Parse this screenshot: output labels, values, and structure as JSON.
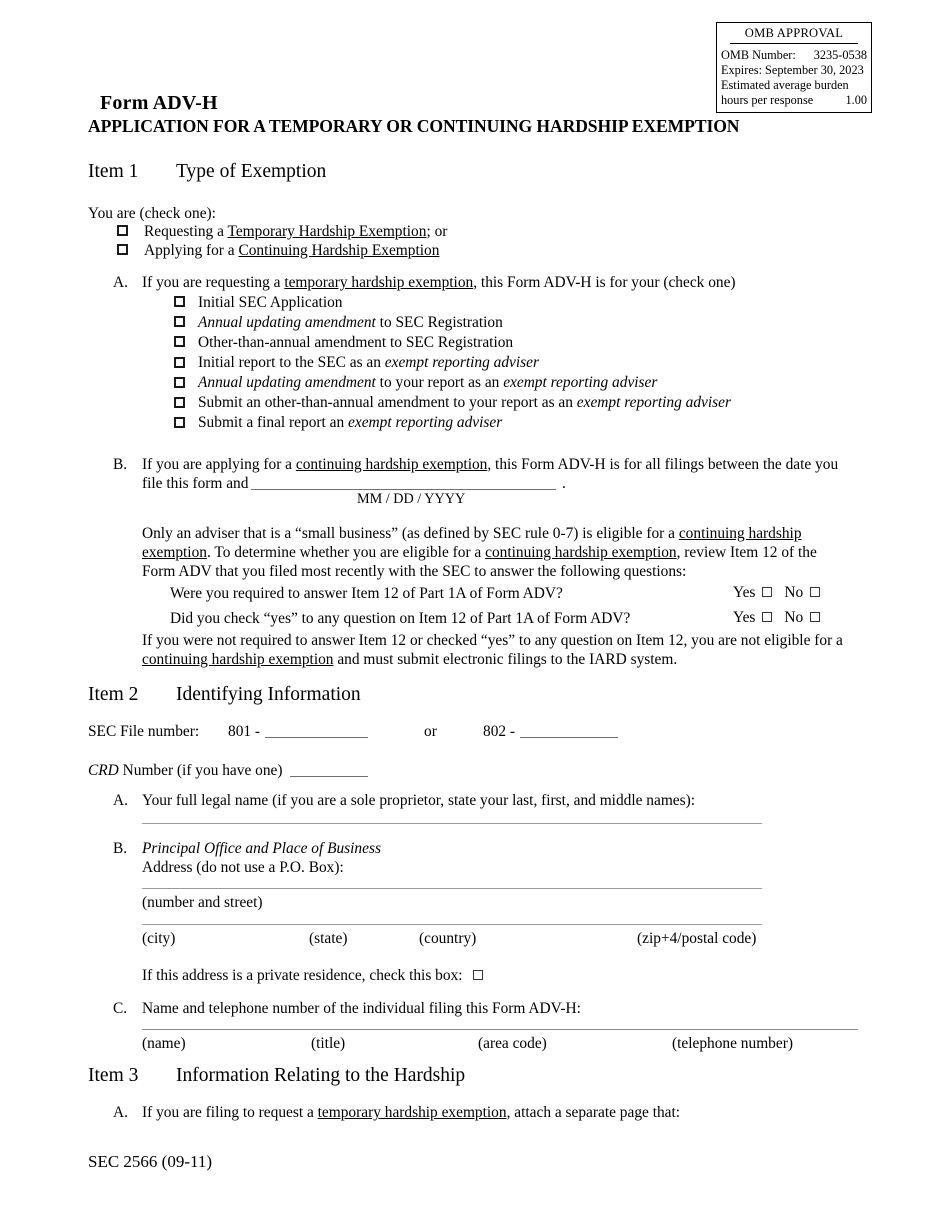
{
  "omb": {
    "title": "OMB APPROVAL",
    "rows": [
      {
        "label": "OMB Number:",
        "value": "3235-0538"
      },
      {
        "label": "Expires:  September 30, 2023",
        "value": ""
      },
      {
        "label": "Estimated average burden",
        "value": ""
      },
      {
        "label": "hours per response",
        "value": "1.00"
      }
    ]
  },
  "header": {
    "form_title": "Form ADV-H",
    "form_subtitle": "APPLICATION FOR A TEMPORARY OR CONTINUING HARDSHIP EXEMPTION"
  },
  "item1": {
    "number": "Item 1",
    "title": "Type of Exemption",
    "intro": "You are (check one):",
    "options": [
      {
        "pre": "Requesting a ",
        "link": "Temporary Hardship Exemption",
        "post": "; or"
      },
      {
        "pre": "Applying for a ",
        "link": "Continuing Hardship Exemption",
        "post": ""
      }
    ],
    "partA": {
      "letter": "A.",
      "pre": "If you are requesting a ",
      "link": "temporary hardship exemption",
      "post": ", this Form ADV-H is for your (check one)",
      "options": [
        "Initial SEC Application",
        "Annual updating amendment to SEC Registration",
        "Other-than-annual amendment to SEC Registration",
        "Initial report to the SEC as an exempt reporting adviser",
        "Annual updating amendment to your report as an exempt reporting adviser",
        "Submit an other-than-annual amendment to your report as an exempt reporting adviser",
        "Submit a final report an exempt reporting adviser"
      ]
    },
    "partB": {
      "letter": "B.",
      "line1_pre": "If you are applying for a ",
      "line1_link": "continuing hardship exemption",
      "line1_post": ", this Form ADV-H is for all filings between the date you",
      "line2_pre": "file this form and",
      "line2_period": ".",
      "date_hint": "MM  /  DD  /  YYYY",
      "para_a1": "Only an adviser that is a “small business” (as defined by SEC rule 0-7) is eligible for a ",
      "para_a_link1": "continuing hardship",
      "para_b_link_cont": "exemption",
      "para_b2": ".  To determine whether you are eligible for a ",
      "para_b_link2": "continuing hardship exemption",
      "para_b3": ", review Item 12 of the",
      "para_c": "Form ADV that you filed most recently with the SEC to answer the following questions:",
      "questions": [
        {
          "text": "Were you required to answer Item 12 of Part 1A of Form ADV?",
          "yes_label": "Yes",
          "no_label": "No"
        },
        {
          "text": "Did you check “yes” to any question on Item 12 of Part 1A of Form ADV?",
          "yes_label": "Yes",
          "no_label": "No"
        }
      ],
      "closing_line1": "If you were not required to answer Item 12 or checked “yes” to any question on Item 12, you are not eligible for a",
      "closing_link": "continuing hardship exemption",
      "closing_line2": " and must submit electronic filings to the IARD system."
    }
  },
  "item2": {
    "number": "Item 2",
    "title": "Identifying Information",
    "sec_file_label": "SEC File number:",
    "sec_file_prefix1": "801 -",
    "or_label": "or",
    "sec_file_prefix2": "802 -",
    "crd_label_italic": "CRD",
    "crd_label_rest": " Number (if you have one)",
    "partA": {
      "letter": "A.",
      "text": "Your full legal name (if you are a sole proprietor, state your last, first, and middle names):"
    },
    "partB": {
      "letter": "B.",
      "heading_italic": "Principal Office and Place of Business",
      "subheading": "Address (do not use a P.O. Box):",
      "street_caption": "(number and street)",
      "captions": [
        "(city)",
        "(state)",
        "(country)",
        "(zip+4/postal code)"
      ],
      "private_residence": "If this address is a private residence, check this box:"
    },
    "partC": {
      "letter": "C.",
      "text": "Name and telephone number of the individual filing this Form ADV-H:",
      "captions": [
        "(name)",
        "(title)",
        "(area code)",
        "(telephone number)"
      ]
    }
  },
  "item3": {
    "number": "Item 3",
    "title": "Information Relating to the Hardship",
    "partA": {
      "letter": "A.",
      "pre": "If you are filing to request a ",
      "link": "temporary hardship exemption",
      "post": ", attach a separate page that:"
    }
  },
  "footer": {
    "text": "SEC 2566 (09-11)"
  }
}
